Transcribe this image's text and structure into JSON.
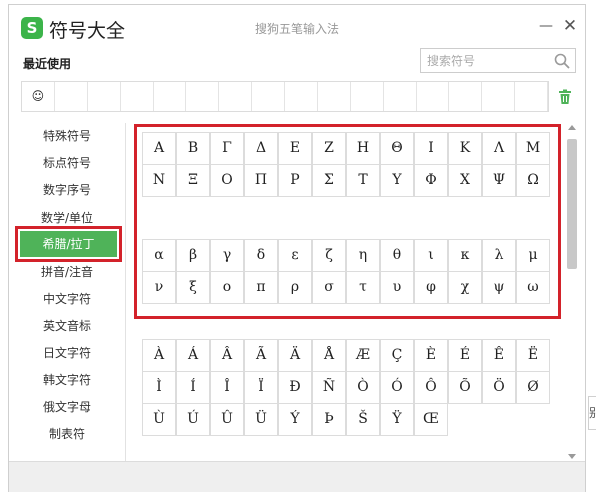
{
  "window": {
    "title": "符号大全",
    "logo_text": "S",
    "ime_name": "搜狗五笔输入法",
    "minimize_glyph": "—",
    "close_glyph": "✕"
  },
  "recent": {
    "label": "最近使用",
    "items": [
      "☺",
      "",
      "",
      "",
      "",
      "",
      "",
      "",
      "",
      "",
      "",
      "",
      "",
      "",
      "",
      ""
    ]
  },
  "search": {
    "placeholder": "搜索符号",
    "value": ""
  },
  "sidebar": {
    "items": [
      {
        "label": "特殊符号"
      },
      {
        "label": "标点符号"
      },
      {
        "label": "数字序号"
      },
      {
        "label": "数学/单位"
      },
      {
        "label": "希腊/拉丁"
      },
      {
        "label": "拼音/注音"
      },
      {
        "label": "中文字符"
      },
      {
        "label": "英文音标"
      },
      {
        "label": "日文字符"
      },
      {
        "label": "韩文字符"
      },
      {
        "label": "俄文字母"
      },
      {
        "label": "制表符"
      }
    ],
    "active_index": 4
  },
  "greek_upper": [
    "Α",
    "Β",
    "Γ",
    "Δ",
    "Ε",
    "Ζ",
    "Η",
    "Θ",
    "Ι",
    "Κ",
    "Λ",
    "Μ",
    "Ν",
    "Ξ",
    "Ο",
    "Π",
    "Ρ",
    "Σ",
    "Τ",
    "Υ",
    "Φ",
    "Χ",
    "Ψ",
    "Ω"
  ],
  "greek_lower": [
    "α",
    "β",
    "γ",
    "δ",
    "ε",
    "ζ",
    "η",
    "θ",
    "ι",
    "κ",
    "λ",
    "μ",
    "ν",
    "ξ",
    "ο",
    "π",
    "ρ",
    "σ",
    "τ",
    "υ",
    "φ",
    "χ",
    "ψ",
    "ω"
  ],
  "latin": [
    "À",
    "Á",
    "Â",
    "Ã",
    "Ä",
    "Å",
    "Æ",
    "Ç",
    "È",
    "É",
    "Ê",
    "Ë",
    "Ì",
    "Í",
    "Î",
    "Ï",
    "Ð",
    "Ñ",
    "Ò",
    "Ó",
    "Ô",
    "Õ",
    "Ö",
    "Ø",
    "Ù",
    "Ú",
    "Û",
    "Ü",
    "Ý",
    "Þ",
    "Š",
    "Ÿ",
    "Œ"
  ],
  "peek_text": "别",
  "colors": {
    "accent_green": "#4fb359",
    "highlight_red": "#d3222a"
  },
  "icons": {
    "search": "search-icon",
    "trash": "trash-icon",
    "logo": "sogou-logo-icon"
  }
}
